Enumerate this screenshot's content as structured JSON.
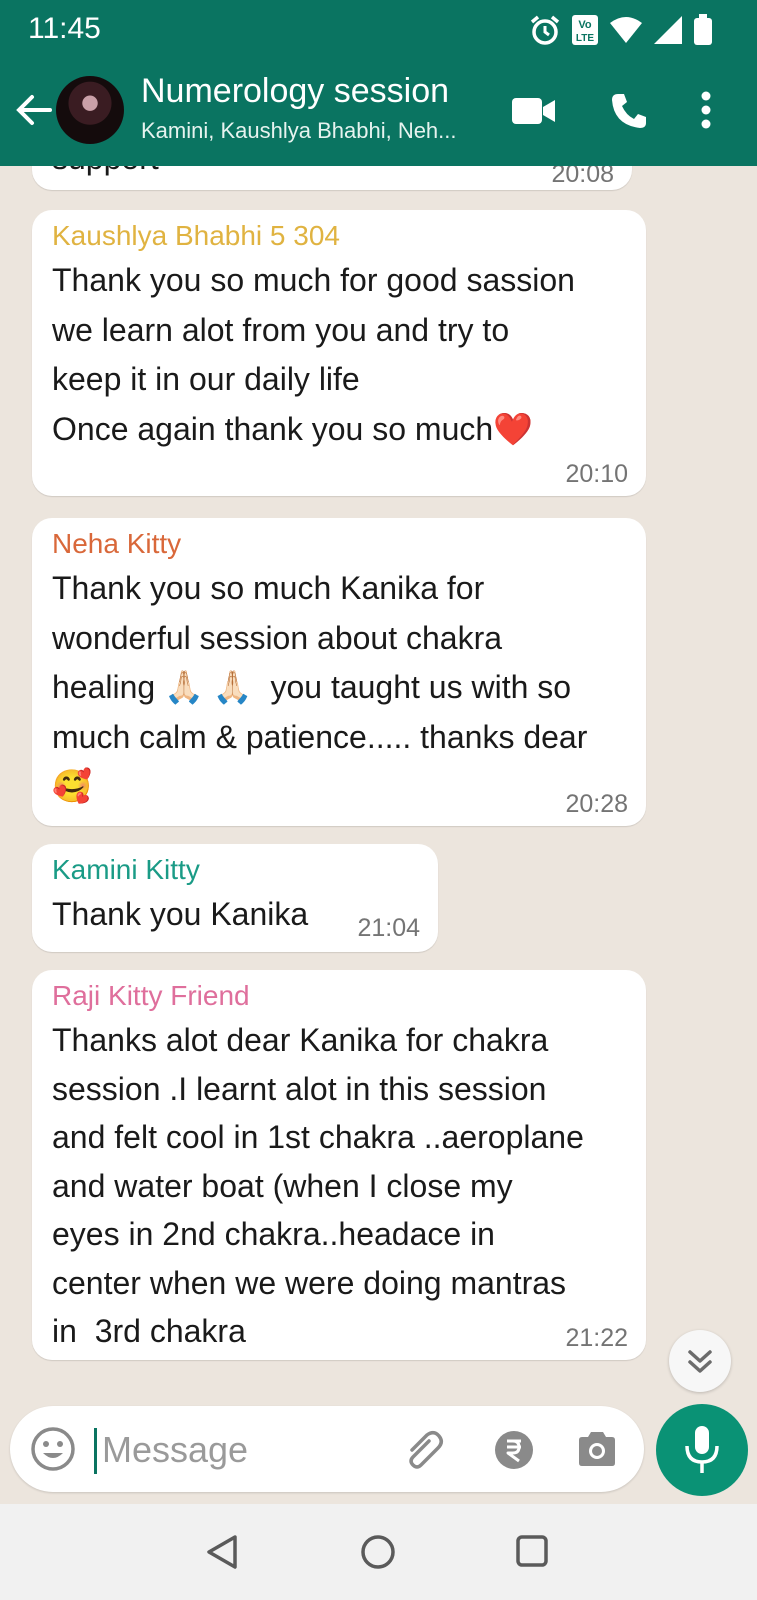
{
  "status_bar": {
    "time": "11:45",
    "volte_label": "Vo\nLTE"
  },
  "header": {
    "title": "Numerology session",
    "subtitle": "Kamini, Kaushlya Bhabhi, Neh..."
  },
  "messages": [
    {
      "sender": "",
      "text": "support",
      "time": "20:08"
    },
    {
      "sender": "Kaushlya Bhabhi 5 304",
      "sender_color": "#e0b341",
      "text": "Thank you so much for good sassion\nwe learn alot from you and try to\nkeep it in our daily life\nOnce again thank you so much❤️",
      "time": "20:10"
    },
    {
      "sender": "Neha Kitty",
      "sender_color": "#d9683a",
      "text": "Thank you so much Kanika for\nwonderful session about chakra\nhealing 🙏🏻 🙏🏻  you taught us with so\nmuch calm & patience..... thanks dear\n🥰",
      "time": "20:28"
    },
    {
      "sender": "Kamini Kitty",
      "sender_color": "#1a9b86",
      "text": "Thank you Kanika",
      "time": "21:04"
    },
    {
      "sender": "Raji Kitty Friend",
      "sender_color": "#df6f9c",
      "text": "Thanks alot dear Kanika for chakra\nsession .I learnt alot in this session\nand felt cool in 1st chakra ..aeroplane\nand water boat (when I close my\neyes in 2nd chakra..headace in\ncenter when we were doing mantras\nin  3rd chakra",
      "time": "21:22"
    }
  ],
  "composer": {
    "placeholder": "Message"
  },
  "colors": {
    "header": "#0a7461",
    "accent": "#0a9275",
    "background": "#ece5dd"
  },
  "icons": {
    "header": [
      "back-arrow-icon",
      "avatar",
      "video-call-icon",
      "phone-icon",
      "more-options-icon"
    ],
    "composer": [
      "emoji-icon",
      "attach-icon",
      "rupee-payment-icon",
      "camera-icon",
      "mic-icon"
    ],
    "nav": [
      "nav-back-icon",
      "nav-home-icon",
      "nav-recents-icon"
    ]
  }
}
